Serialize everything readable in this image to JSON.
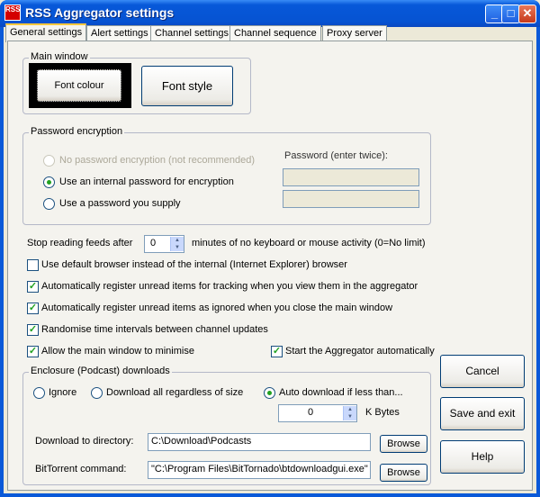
{
  "window": {
    "title": "RSS Aggregator settings",
    "icon_text": "RSS"
  },
  "tabs": [
    {
      "label": "General settings"
    },
    {
      "label": "Alert settings"
    },
    {
      "label": "Channel settings"
    },
    {
      "label": "Channel sequence"
    },
    {
      "label": "Proxy server"
    }
  ],
  "main_window": {
    "legend": "Main window",
    "font_colour": "Font colour",
    "font_style": "Font style"
  },
  "password": {
    "legend": "Password encryption",
    "opt_none": "No password encryption (not recommended)",
    "opt_internal": "Use an internal password for encryption",
    "opt_supply": "Use a password you supply",
    "field_label": "Password (enter twice):"
  },
  "stop_reading": {
    "before": "Stop reading feeds after",
    "value": "0",
    "after": "minutes of no keyboard or mouse activity (0=No limit)"
  },
  "checks": {
    "default_browser": "Use default browser instead of the internal (Internet Explorer) browser",
    "register_view": "Automatically register unread items for tracking when you view them in the aggregator",
    "register_close": "Automatically register unread items as ignored when you close the main window",
    "randomise": "Randomise time intervals between channel updates",
    "minimise": "Allow the main window to minimise",
    "start_auto": "Start the Aggregator automatically"
  },
  "enclosure": {
    "legend": "Enclosure (Podcast) downloads",
    "opt_ignore": "Ignore",
    "opt_all": "Download all regardless of size",
    "opt_auto": "Auto download if less than...",
    "size_value": "0",
    "size_unit": "K Bytes",
    "dir_label": "Download to directory:",
    "dir_value": "C:\\Download\\Podcasts",
    "bt_label": "BitTorrent command:",
    "bt_value": "\"C:\\Program Files\\BitTornado\\btdownloadgui.exe\"",
    "browse": "Browse"
  },
  "actions": {
    "cancel": "Cancel",
    "save": "Save and exit",
    "help": "Help"
  }
}
